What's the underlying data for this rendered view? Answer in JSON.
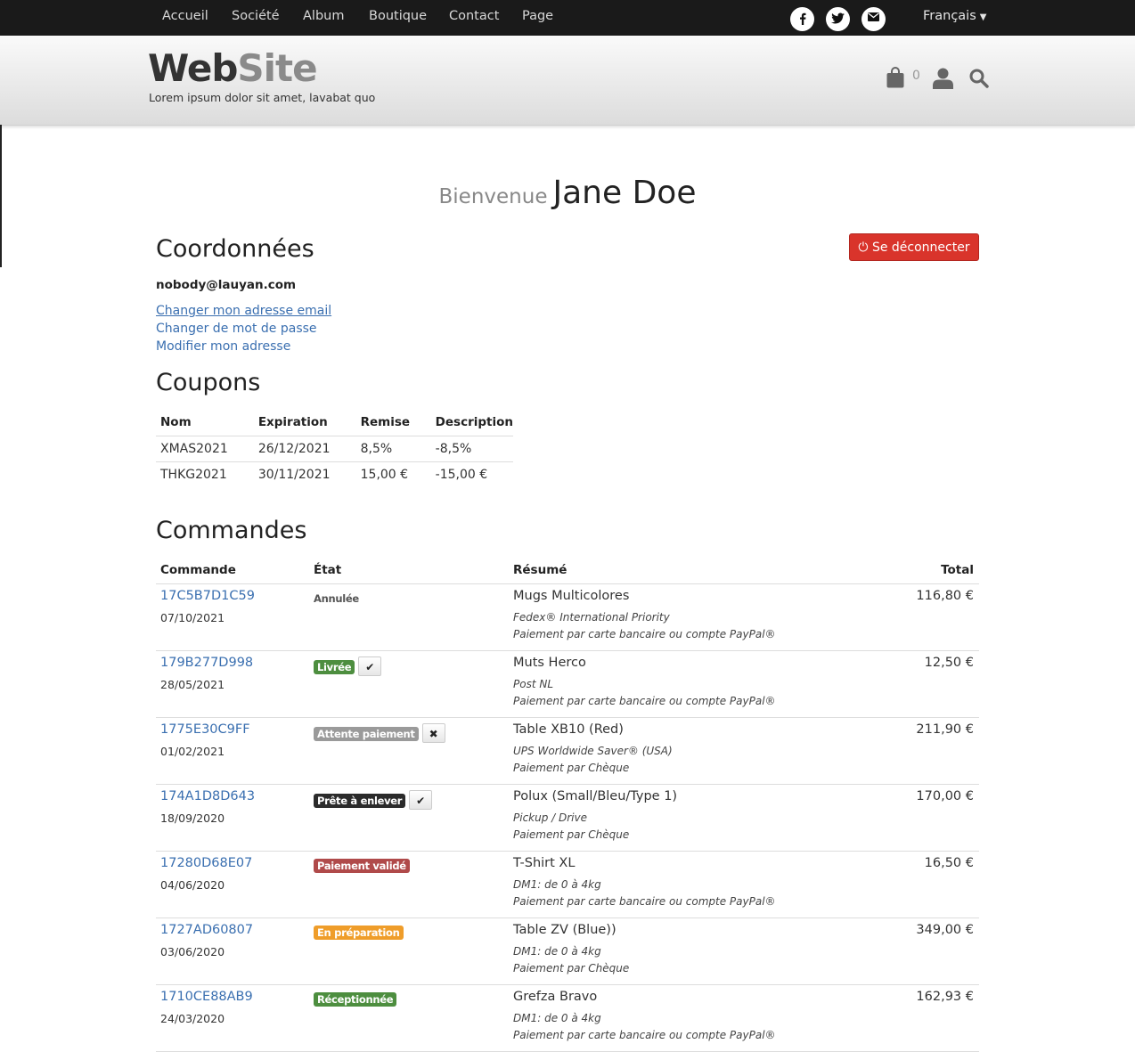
{
  "nav": {
    "items": [
      "Accueil",
      "Société",
      "Album",
      "Boutique",
      "Contact",
      "Page"
    ],
    "language": "Français",
    "social": [
      "facebook-icon",
      "twitter-icon",
      "email-icon"
    ]
  },
  "header": {
    "logo_part1": "Web",
    "logo_part2": "Site",
    "tagline": "Lorem ipsum dolor sit amet, lavabat quo",
    "cart_count": "0"
  },
  "welcome": {
    "prefix": "Bienvenue",
    "name": "Jane Doe"
  },
  "account": {
    "heading": "Coordonnées",
    "email": "nobody@lauyan.com",
    "logout_label": "Se déconnecter",
    "links": [
      "Changer mon adresse email",
      "Changer de mot de passe",
      "Modifier mon adresse"
    ]
  },
  "coupons": {
    "heading": "Coupons",
    "columns": [
      "Nom",
      "Expiration",
      "Remise",
      "Description"
    ],
    "rows": [
      [
        "XMAS2021",
        "26/12/2021",
        "8,5%",
        "-8,5%"
      ],
      [
        "THKG2021",
        "30/11/2021",
        "15,00 €",
        "-15,00 €"
      ]
    ]
  },
  "orders": {
    "heading": "Commandes",
    "columns": [
      "Commande",
      "État",
      "Résumé",
      "Total"
    ],
    "rows": [
      {
        "id": "17C5B7D1C59",
        "date": "07/10/2021",
        "status": "Annulée",
        "status_color": "",
        "action": "",
        "title": "Mugs Multicolores",
        "shipping": "Fedex® International Priority",
        "payment": "Paiement par carte bancaire ou compte PayPal®",
        "total": "116,80 €"
      },
      {
        "id": "179B277D998",
        "date": "28/05/2021",
        "status": "Livrée",
        "status_color": "#4d8e3f",
        "action": "✔",
        "title": "Muts Herco",
        "shipping": "Post NL",
        "payment": "Paiement par carte bancaire ou compte PayPal®",
        "total": "12,50 €"
      },
      {
        "id": "1775E30C9FF",
        "date": "01/02/2021",
        "status": "Attente paiement",
        "status_color": "#9a9a9a",
        "action": "✖",
        "title": "Table XB10 (Red)",
        "shipping": "UPS Worldwide Saver® (USA)",
        "payment": "Paiement par Chèque",
        "total": "211,90 €"
      },
      {
        "id": "174A1D8D643",
        "date": "18/09/2020",
        "status": "Prête à enlever",
        "status_color": "#2b2b2b",
        "action": "✔",
        "title": "Polux (Small/Bleu/Type 1)",
        "shipping": "Pickup / Drive",
        "payment": "Paiement par Chèque",
        "total": "170,00 €"
      },
      {
        "id": "17280D68E07",
        "date": "04/06/2020",
        "status": "Paiement validé",
        "status_color": "#b04a4a",
        "action": "",
        "title": "T-Shirt XL",
        "shipping": "DM1: de 0 à 4kg",
        "payment": "Paiement par carte bancaire ou compte PayPal®",
        "total": "16,50 €"
      },
      {
        "id": "1727AD60807",
        "date": "03/06/2020",
        "status": "En préparation",
        "status_color": "#ef9d2a",
        "action": "",
        "title": "Table ZV (Blue))",
        "shipping": "DM1: de 0 à 4kg",
        "payment": "Paiement par Chèque",
        "total": "349,00 €"
      },
      {
        "id": "1710CE88AB9",
        "date": "24/03/2020",
        "status": "Réceptionnée",
        "status_color": "#4d8e3f",
        "action": "",
        "title": "Grefza Bravo",
        "shipping": "DM1: de 0 à 4kg",
        "payment": "Paiement par carte bancaire ou compte PayPal®",
        "total": "162,93 €"
      }
    ]
  }
}
